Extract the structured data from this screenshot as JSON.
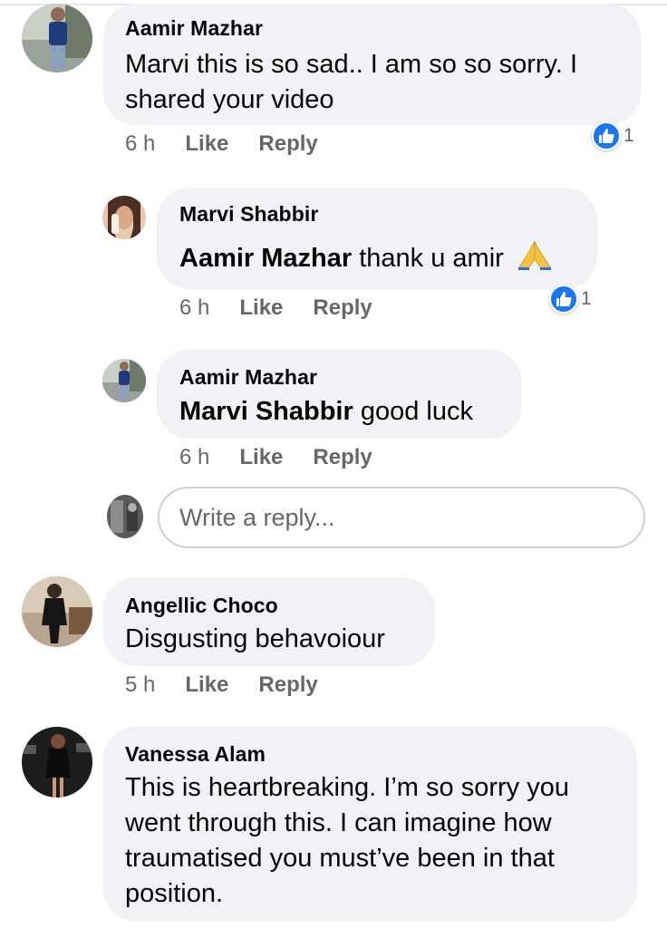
{
  "thread": {
    "reply_placeholder": "Write a reply...",
    "comments": [
      {
        "author": "Aamir Mazhar",
        "text_line1": "Marvi this is so sad.. I am so so sorry. I",
        "text_line2": "shared your video",
        "time": "6 h",
        "like_label": "Like",
        "reply_label": "Reply",
        "reaction_count": "1"
      },
      {
        "author": "Marvi Shabbir",
        "mention": "Aamir Mazhar",
        "text": "thank u amir",
        "emoji": "folded-hands-emoji",
        "time": "6 h",
        "like_label": "Like",
        "reply_label": "Reply",
        "reaction_count": "1"
      },
      {
        "author": "Aamir Mazhar",
        "mention": "Marvi Shabbir",
        "text": "good luck",
        "time": "6 h",
        "like_label": "Like",
        "reply_label": "Reply"
      },
      {
        "author": "Angellic Choco",
        "text": "Disgusting behavoiour",
        "time": "5 h",
        "like_label": "Like",
        "reply_label": "Reply"
      },
      {
        "author": "Vanessa Alam",
        "text_line1": "This is heartbreaking. I’m so sorry you",
        "text_line2": "went through this. I can imagine how",
        "text_line3": "traumatised you must’ve been in that",
        "text_line4": "position."
      }
    ]
  },
  "colors": {
    "bubble": "#f0f2f5",
    "meta_text": "#65676b",
    "like_blue": "#1877f2",
    "input_border": "#ccd0d5"
  }
}
